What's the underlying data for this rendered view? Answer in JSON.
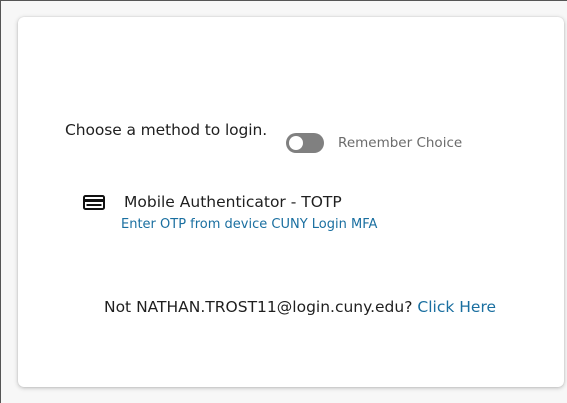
{
  "login": {
    "prompt": "Choose a method to login.",
    "remember_label": "Remember Choice",
    "remember_on": false
  },
  "method": {
    "icon": "card-icon",
    "title": "Mobile Authenticator - TOTP",
    "subtitle": "Enter OTP from device CUNY Login MFA"
  },
  "footer": {
    "not_user_text": "Not NATHAN.TROST11@login.cuny.edu?",
    "click_here": "Click Here"
  },
  "colors": {
    "link": "#1a6fa0",
    "toggle_off": "#808080"
  }
}
